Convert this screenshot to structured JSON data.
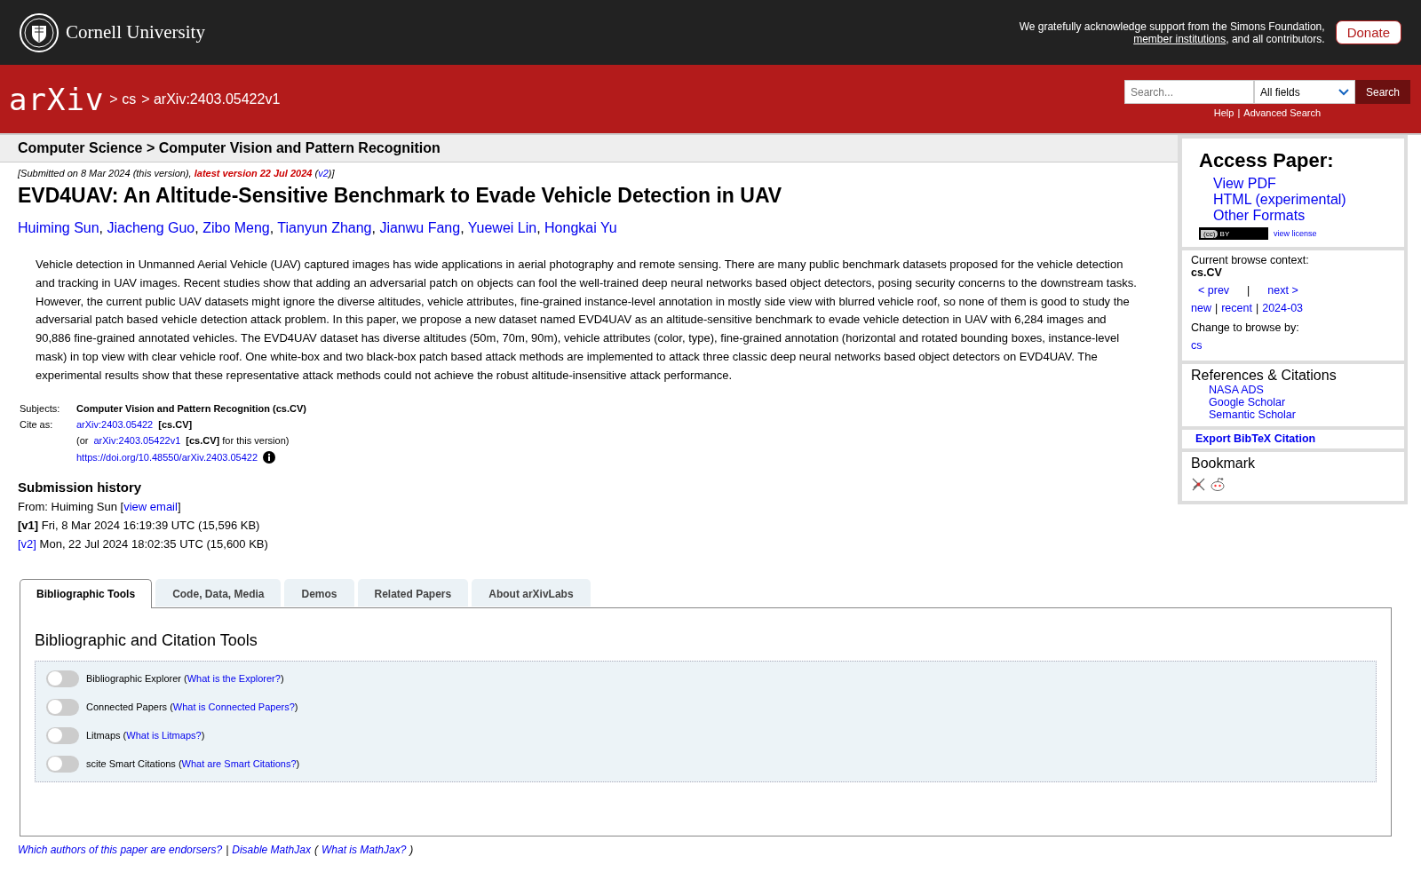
{
  "top_bar": {
    "university": "Cornell University",
    "support_text": "We gratefully acknowledge support from the Simons Foundation,",
    "support_link": "member institutions",
    "support_tail": ", and all contributors.",
    "donate": "Donate"
  },
  "nav_bar": {
    "logo": "arXiv",
    "breadcrumb": [
      {
        "label": "> cs"
      },
      {
        "label": "> arXiv:2403.05422v1"
      }
    ],
    "search": {
      "placeholder": "Search...",
      "field_select": "All fields",
      "button": "Search"
    },
    "help_links": [
      {
        "label": "Help"
      },
      {
        "label": "Advanced Search"
      }
    ],
    "help_sep": "|"
  },
  "subheader": "Computer Science > Computer Vision and Pattern Recognition",
  "paper": {
    "dateline_prefix": "[Submitted on 8 Mar 2024 (this version),",
    "latest_version": "latest version 22 Jul 2024",
    "latest_open": "(",
    "latest_link": "v2",
    "dateline_suffix": ")]",
    "title": "EVD4UAV: An Altitude-Sensitive Benchmark to Evade Vehicle Detection in UAV",
    "author_sep": ",",
    "authors": [
      "Huiming Sun",
      "Jiacheng Guo",
      "Zibo Meng",
      "Tianyun Zhang",
      "Jianwu Fang",
      "Yuewei Lin",
      "Hongkai Yu"
    ],
    "abstract": "Vehicle detection in Unmanned Aerial Vehicle (UAV) captured images has wide applications in aerial photography and remote sensing. There are many public benchmark datasets proposed for the vehicle detection and tracking in UAV images. Recent studies show that adding an adversarial patch on objects can fool the well-trained deep neural networks based object detectors, posing security concerns to the downstream tasks. However, the current public UAV datasets might ignore the diverse altitudes, vehicle attributes, fine-grained instance-level annotation in mostly side view with blurred vehicle roof, so none of them is good to study the adversarial patch based vehicle detection attack problem. In this paper, we propose a new dataset named EVD4UAV as an altitude-sensitive benchmark to evade vehicle detection in UAV with 6,284 images and 90,886 fine-grained annotated vehicles. The EVD4UAV dataset has diverse altitudes (50m, 70m, 90m), vehicle attributes (color, type), fine-grained annotation (horizontal and rotated bounding boxes, instance-level mask) in top view with clear vehicle roof. One white-box and two black-box patch based attack methods are implemented to attack three classic deep neural networks based object detectors on EVD4UAV. The experimental results show that these representative attack methods could not achieve the robust altitude-insensitive attack performance.",
    "subjects_label": "Subjects:",
    "subjects": "Computer Vision and Pattern Recognition (cs.CV)",
    "cite_label": "Cite as:",
    "cite_lines": [
      {
        "link": "arXiv:2403.05422",
        "suffix": "**[cs.CV]**"
      },
      {
        "prefix": "(or",
        "link": "arXiv:2403.05422v1",
        "suffix": "**[cs.CV]** for this version)"
      },
      {
        "link": "https://doi.org/10.48550/arXiv.2403.05422",
        "info_icon": true
      }
    ]
  },
  "history": {
    "heading": "Submission history",
    "from": "From: Huiming Sun [",
    "email_link": "view email",
    "from_tail": "]",
    "versions": [
      {
        "label": "[v1]",
        "current": true,
        "text": "Fri, 8 Mar 2024 16:19:39 UTC (15,596 KB)"
      },
      {
        "label": "[v2]",
        "current": false,
        "text": "Mon, 22 Jul 2024 18:02:35 UTC (15,600 KB)"
      }
    ]
  },
  "sidebar": {
    "access_heading": "Access Paper:",
    "access_links": [
      "View PDF",
      "HTML (experimental)",
      "Other Formats"
    ],
    "license_badge": {
      "cc": "(cc)",
      "by": "BY"
    },
    "license_link": "view license",
    "context_label": "Current browse context:",
    "context": "cs.CV",
    "prev": "< prev",
    "sep": "|",
    "next": "next >",
    "browse_links": [
      "new",
      "recent",
      "2024-03"
    ],
    "browse_sep": "|",
    "change_label": "Change to browse by:",
    "change_links": [
      "cs"
    ],
    "refs_heading": "References & Citations",
    "refs_links": [
      "NASA ADS",
      "Google Scholar",
      "Semantic Scholar"
    ],
    "export": "Export BibTeX Citation",
    "bookmark_heading": "Bookmark"
  },
  "tabs": [
    {
      "label": "Bibliographic Tools",
      "selected": true
    },
    {
      "label": "Code, Data, Media",
      "selected": false
    },
    {
      "label": "Demos",
      "selected": false
    },
    {
      "label": "Related Papers",
      "selected": false
    },
    {
      "label": "About arXivLabs",
      "selected": false
    }
  ],
  "tools": {
    "heading": "Bibliographic and Citation Tools",
    "open": "(",
    "close": ")",
    "items": [
      {
        "name": "Bibliographic Explorer",
        "link": "What is the Explorer?",
        "on": false
      },
      {
        "name": "Connected Papers",
        "link": "What is Connected Papers?",
        "on": false
      },
      {
        "name": "Litmaps",
        "link": "What is Litmaps?",
        "on": false
      },
      {
        "name": "scite Smart Citations",
        "link": "What are Smart Citations?",
        "on": false
      }
    ]
  },
  "footer": {
    "sep": "|",
    "open": "(",
    "close": ")",
    "links": [
      {
        "label": "Which authors of this paper are endorsers?"
      },
      {
        "label": "Disable MathJax"
      },
      {
        "label": "What is MathJax?"
      }
    ]
  }
}
